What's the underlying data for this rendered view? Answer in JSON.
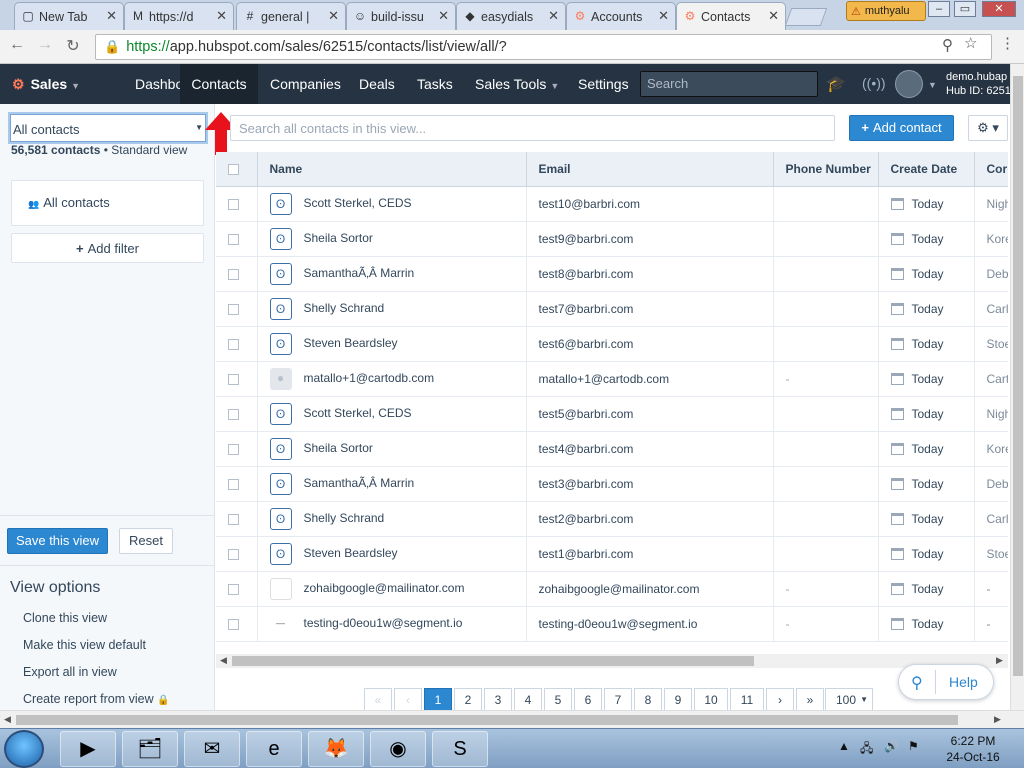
{
  "browser": {
    "tabs": [
      {
        "label": "New Tab",
        "icon": "blank-page-icon"
      },
      {
        "label": "https://d",
        "icon": "gmail-icon"
      },
      {
        "label": "general |",
        "icon": "slack-icon"
      },
      {
        "label": "build-issu",
        "icon": "avatar-icon"
      },
      {
        "label": "easydials",
        "icon": "easydials-icon"
      },
      {
        "label": "Accounts",
        "icon": "hubspot-icon"
      },
      {
        "label": "Contacts",
        "icon": "hubspot-icon"
      }
    ],
    "profile_name": "muthyalu",
    "url_scheme": "https://",
    "url_rest": "app.hubspot.com/sales/62515/contacts/list/view/all/?"
  },
  "hubspot_nav": {
    "brand": "Sales",
    "items": [
      "Dashboard",
      "Contacts",
      "Companies",
      "Deals",
      "Tasks",
      "Sales Tools",
      "Settings"
    ],
    "search_placeholder": "Search",
    "portal_domain": "demo.hubap",
    "hub_id": "Hub ID: 6251"
  },
  "sidebar": {
    "view_name": "All contacts",
    "contact_count": "56,581 contacts",
    "view_type": "• Standard view",
    "list_card_label": "All contacts",
    "add_filter_label": "Add filter",
    "save_view_label": "Save this view",
    "reset_label": "Reset",
    "view_options_title": "View options",
    "view_options": [
      "Clone this view",
      "Make this view default",
      "Export all in view",
      "Create report from view"
    ]
  },
  "toolbar": {
    "search_placeholder": "Search all contacts in this view...",
    "add_contact_label": "Add contact"
  },
  "table": {
    "columns": [
      "Name",
      "Email",
      "Phone Number",
      "Create Date",
      "Cor"
    ],
    "rows": [
      {
        "avatar": "barbri",
        "name": "Scott Sterkel, CEDS",
        "email": "test10@barbri.com",
        "phone": "",
        "date": "Today",
        "cor": "Nigh"
      },
      {
        "avatar": "barbri",
        "name": "Sheila Sortor",
        "email": "test9@barbri.com",
        "phone": "",
        "date": "Today",
        "cor": "Kore"
      },
      {
        "avatar": "barbri",
        "name": "SamanthaÃ‚Â  Marrin",
        "email": "test8@barbri.com",
        "phone": "",
        "date": "Today",
        "cor": "Deb"
      },
      {
        "avatar": "barbri",
        "name": "Shelly Schrand",
        "email": "test7@barbri.com",
        "phone": "",
        "date": "Today",
        "cor": "Carl"
      },
      {
        "avatar": "barbri",
        "name": "Steven Beardsley",
        "email": "test6@barbri.com",
        "phone": "",
        "date": "Today",
        "cor": "Stoe"
      },
      {
        "avatar": "person",
        "name": "matallo+1@cartodb.com",
        "email": "matallo+1@cartodb.com",
        "phone": "-",
        "date": "Today",
        "cor": "Cart"
      },
      {
        "avatar": "barbri",
        "name": "Scott Sterkel, CEDS",
        "email": "test5@barbri.com",
        "phone": "",
        "date": "Today",
        "cor": "Nigh"
      },
      {
        "avatar": "barbri",
        "name": "Sheila Sortor",
        "email": "test4@barbri.com",
        "phone": "",
        "date": "Today",
        "cor": "Kore"
      },
      {
        "avatar": "barbri",
        "name": "SamanthaÃ‚Â  Marrin",
        "email": "test3@barbri.com",
        "phone": "",
        "date": "Today",
        "cor": "Deb"
      },
      {
        "avatar": "barbri",
        "name": "Shelly Schrand",
        "email": "test2@barbri.com",
        "phone": "",
        "date": "Today",
        "cor": "Carl"
      },
      {
        "avatar": "barbri",
        "name": "Steven Beardsley",
        "email": "test1@barbri.com",
        "phone": "",
        "date": "Today",
        "cor": "Stoe"
      },
      {
        "avatar": "blank",
        "name": "zohaibgoogle@mailinator.com",
        "email": "zohaibgoogle@mailinator.com",
        "phone": "-",
        "date": "Today",
        "cor": "-"
      },
      {
        "avatar": "segment",
        "name": "testing-d0eou1w@segment.io",
        "email": "testing-d0eou1w@segment.io",
        "phone": "-",
        "date": "Today",
        "cor": "-"
      }
    ]
  },
  "pagination": {
    "first": "«",
    "prev": "‹",
    "pages": [
      "1",
      "2",
      "3",
      "4",
      "5",
      "6",
      "7",
      "8",
      "9",
      "10",
      "11"
    ],
    "current": "1",
    "next": "›",
    "last": "»",
    "per_page": "100"
  },
  "help_label": "Help",
  "taskbar": {
    "time": "6:22 PM",
    "date": "24-Oct-16"
  },
  "colors": {
    "hubspot_nav_bg": "#253342",
    "primary_button": "#2d88d2",
    "annotation_arrow": "#e8121c"
  }
}
